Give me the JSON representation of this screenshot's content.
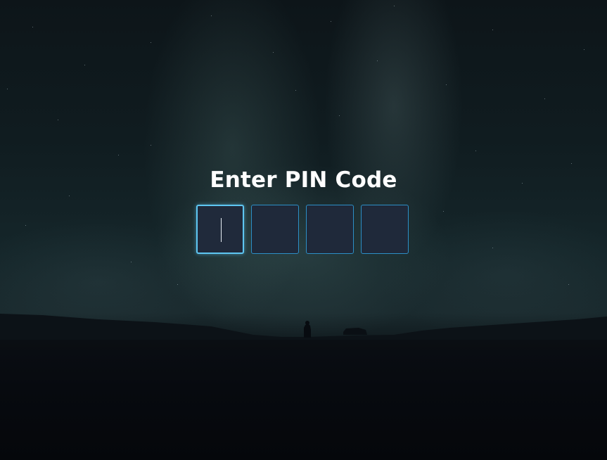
{
  "title": "Enter PIN Code",
  "pin": {
    "digits": [
      "",
      "",
      "",
      ""
    ],
    "focused_index": 0
  },
  "colors": {
    "box_fill": "#1f293a",
    "box_border": "#2c8fc7",
    "active_border": "#5ec6f2",
    "title_text": "#ffffff"
  }
}
